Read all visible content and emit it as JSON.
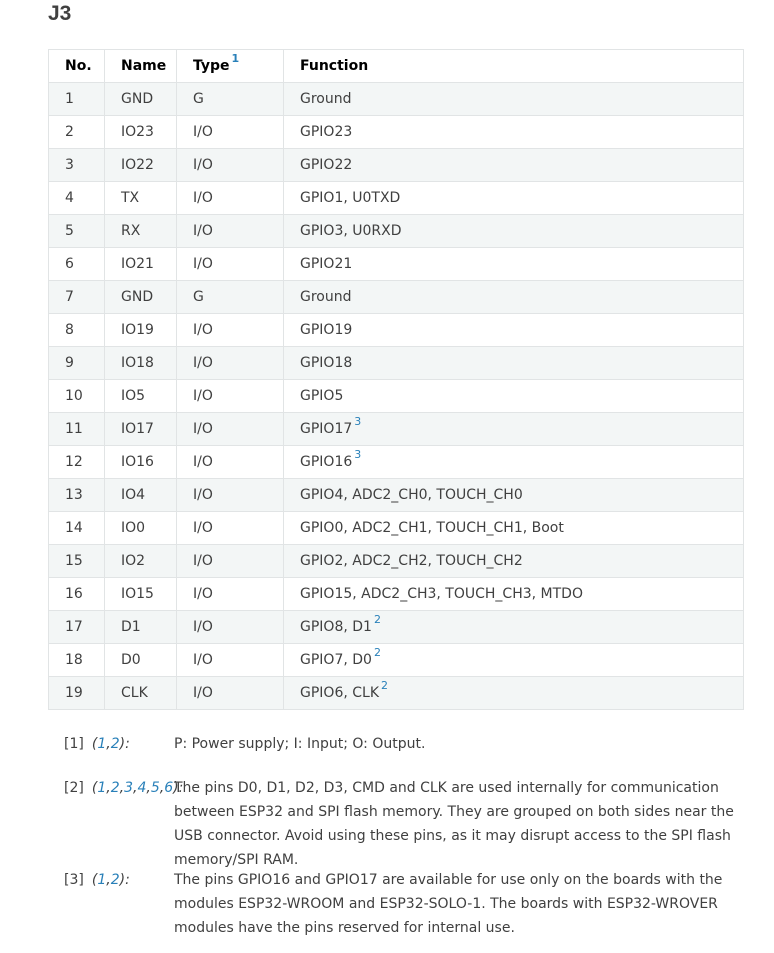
{
  "section": {
    "title": "J3"
  },
  "table": {
    "headers": {
      "no": "No.",
      "name": "Name",
      "type": "Type",
      "type_ref": "1",
      "function": "Function"
    },
    "rows": [
      {
        "no": "1",
        "name": "GND",
        "type": "G",
        "function": "Ground",
        "ref": ""
      },
      {
        "no": "2",
        "name": "IO23",
        "type": "I/O",
        "function": "GPIO23",
        "ref": ""
      },
      {
        "no": "3",
        "name": "IO22",
        "type": "I/O",
        "function": "GPIO22",
        "ref": ""
      },
      {
        "no": "4",
        "name": "TX",
        "type": "I/O",
        "function": "GPIO1, U0TXD",
        "ref": ""
      },
      {
        "no": "5",
        "name": "RX",
        "type": "I/O",
        "function": "GPIO3, U0RXD",
        "ref": ""
      },
      {
        "no": "6",
        "name": "IO21",
        "type": "I/O",
        "function": "GPIO21",
        "ref": ""
      },
      {
        "no": "7",
        "name": "GND",
        "type": "G",
        "function": "Ground",
        "ref": ""
      },
      {
        "no": "8",
        "name": "IO19",
        "type": "I/O",
        "function": "GPIO19",
        "ref": ""
      },
      {
        "no": "9",
        "name": "IO18",
        "type": "I/O",
        "function": "GPIO18",
        "ref": ""
      },
      {
        "no": "10",
        "name": "IO5",
        "type": "I/O",
        "function": "GPIO5",
        "ref": ""
      },
      {
        "no": "11",
        "name": "IO17",
        "type": "I/O",
        "function": "GPIO17",
        "ref": "3"
      },
      {
        "no": "12",
        "name": "IO16",
        "type": "I/O",
        "function": "GPIO16",
        "ref": "3"
      },
      {
        "no": "13",
        "name": "IO4",
        "type": "I/O",
        "function": "GPIO4, ADC2_CH0, TOUCH_CH0",
        "ref": ""
      },
      {
        "no": "14",
        "name": "IO0",
        "type": "I/O",
        "function": "GPIO0, ADC2_CH1, TOUCH_CH1, Boot",
        "ref": ""
      },
      {
        "no": "15",
        "name": "IO2",
        "type": "I/O",
        "function": "GPIO2, ADC2_CH2, TOUCH_CH2",
        "ref": ""
      },
      {
        "no": "16",
        "name": "IO15",
        "type": "I/O",
        "function": "GPIO15, ADC2_CH3, TOUCH_CH3, MTDO",
        "ref": ""
      },
      {
        "no": "17",
        "name": "D1",
        "type": "I/O",
        "function": "GPIO8, D1",
        "ref": "2"
      },
      {
        "no": "18",
        "name": "D0",
        "type": "I/O",
        "function": "GPIO7, D0",
        "ref": "2"
      },
      {
        "no": "19",
        "name": "CLK",
        "type": "I/O",
        "function": "GPIO6, CLK",
        "ref": "2"
      }
    ]
  },
  "footnotes": [
    {
      "label": "[1]",
      "backrefs": [
        "1",
        "2"
      ],
      "text": "P: Power supply; I: Input; O: Output."
    },
    {
      "label": "[2]",
      "backrefs": [
        "1",
        "2",
        "3",
        "4",
        "5",
        "6"
      ],
      "text": "The pins D0, D1, D2, D3, CMD and CLK are used internally for communication between ESP32 and SPI flash memory. They are grouped on both sides near the USB connector. Avoid using these pins, as it may disrupt access to the SPI flash memory/SPI RAM."
    },
    {
      "label": "[3]",
      "backrefs": [
        "1",
        "2"
      ],
      "text": "The pins GPIO16 and GPIO17 are available for use only on the boards with the modules ESP32-WROOM and ESP32-SOLO-1. The boards with ESP32-WROVER modules have the pins reserved for internal use."
    }
  ],
  "colors": {
    "link": "#2980b9",
    "text": "#404040",
    "row_alt": "#f3f6f6",
    "border": "#e1e4e5"
  }
}
